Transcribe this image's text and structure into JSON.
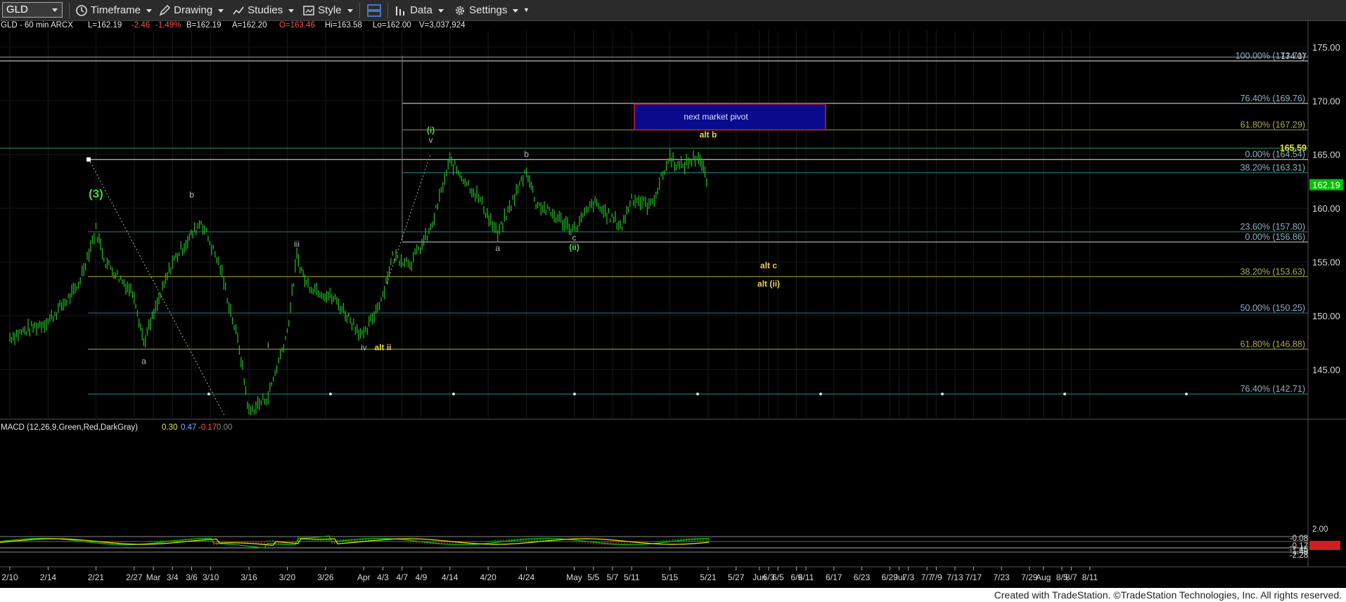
{
  "toolbar": {
    "symbol": "GLD",
    "timeframe": "Timeframe",
    "drawing": "Drawing",
    "studies": "Studies",
    "style": "Style",
    "data": "Data",
    "settings": "Settings"
  },
  "header": {
    "symbol_desc": "GLD - 60 min  ARCX",
    "last": "L=162.19",
    "change": "-2.46",
    "pct": "-1.49%",
    "bid": "B=162.19",
    "ask": "A=162.20",
    "open": "O=163.46",
    "high": "Hi=163.58",
    "low": "Lo=162.00",
    "volume": "V=3,037,924"
  },
  "colors": {
    "background": "#000000",
    "bars": "#22c022",
    "white_label": "#aeb8c8",
    "green_label": "#4dd24d",
    "yellow_label": "#e8d44d",
    "level_teal": "#1e6e6e",
    "level_olive": "#8a8a2a",
    "pivot_box": "#0a0a8c",
    "pivot_border": "#d01e1e",
    "last_price_bg": "#00c000",
    "macd_line": "#00c000",
    "signal_line": "#e0e000",
    "histogram_neg": "#d02020"
  },
  "chart_data": {
    "type": "line",
    "title": "GLD - 60 min",
    "ylim": [
      140.5,
      176.5
    ],
    "y_ticks": [
      145.0,
      150.0,
      155.0,
      160.0,
      165.0,
      170.0,
      175.0
    ],
    "x_tick_labels": [
      "2/10",
      "2/14",
      "2/21",
      "2/27",
      "Mar",
      "3/4",
      "3/6",
      "3/10",
      "3/16",
      "3/20",
      "3/26",
      "Apr",
      "4/3",
      "4/7",
      "4/9",
      "4/14",
      "4/20",
      "4/24",
      "May",
      "5/5",
      "5/7",
      "5/11",
      "5/15",
      "5/21",
      "5/27",
      "Jun",
      "6/3",
      "6/5",
      "6/9",
      "6/11",
      "6/17",
      "6/23",
      "6/29",
      "Jul",
      "7/3",
      "7/7",
      "7/9",
      "7/13",
      "7/17",
      "7/23",
      "7/29",
      "Aug",
      "8/5",
      "8/7",
      "8/11"
    ],
    "price_path": [
      {
        "x": "2/10",
        "y": 148.0
      },
      {
        "x": "2/14",
        "y": 149.5
      },
      {
        "x": "2/19",
        "y": 152.5
      },
      {
        "x": "2/21",
        "y": 158.0
      },
      {
        "x": "2/24",
        "y": 155.0
      },
      {
        "x": "2/27",
        "y": 152.0
      },
      {
        "x": "2/28",
        "y": 147.5
      },
      {
        "x": "3/4",
        "y": 155.0
      },
      {
        "x": "3/7",
        "y": 158.8
      },
      {
        "x": "3/11",
        "y": 154.5
      },
      {
        "x": "3/13",
        "y": 147.0
      },
      {
        "x": "3/16",
        "y": 141.0
      },
      {
        "x": "3/18",
        "y": 142.5
      },
      {
        "x": "3/20",
        "y": 148.5
      },
      {
        "x": "3/21",
        "y": 155.5
      },
      {
        "x": "3/24",
        "y": 153.0
      },
      {
        "x": "3/27",
        "y": 151.5
      },
      {
        "x": "4/1",
        "y": 148.0
      },
      {
        "x": "4/3",
        "y": 152.0
      },
      {
        "x": "4/6",
        "y": 155.5
      },
      {
        "x": "4/8",
        "y": 155.0
      },
      {
        "x": "4/10",
        "y": 158.0
      },
      {
        "x": "4/14",
        "y": 164.4
      },
      {
        "x": "4/17",
        "y": 161.0
      },
      {
        "x": "4/21",
        "y": 157.5
      },
      {
        "x": "4/24",
        "y": 163.6
      },
      {
        "x": "4/27",
        "y": 160.5
      },
      {
        "x": "5/1",
        "y": 158.0
      },
      {
        "x": "5/5",
        "y": 160.5
      },
      {
        "x": "5/8",
        "y": 158.3
      },
      {
        "x": "5/11",
        "y": 161.0
      },
      {
        "x": "5/13",
        "y": 160.2
      },
      {
        "x": "5/15",
        "y": 164.8
      },
      {
        "x": "5/18",
        "y": 163.8
      },
      {
        "x": "5/20",
        "y": 164.9
      },
      {
        "x": "5/21",
        "y": 162.19
      }
    ],
    "levels": [
      {
        "label": "100.00% (173.71)",
        "value": 173.71
      },
      {
        "label": "76.40% (169.76)",
        "value": 169.76
      },
      {
        "label": "61.80% (167.29)",
        "value": 167.29
      },
      {
        "label": "0.00% (164.54)",
        "value": 164.54
      },
      {
        "label": "38.20% (163.31)",
        "value": 163.31
      },
      {
        "label": "23.60% (157.80)",
        "value": 157.8
      },
      {
        "label": "0.00% (156.86)",
        "value": 156.86
      },
      {
        "label": "38.20% (153.63)",
        "value": 153.63
      },
      {
        "label": "50.00% (150.25)",
        "value": 150.25
      },
      {
        "label": "61.80% (146.88)",
        "value": 146.88
      },
      {
        "label": "76.40% (142.71)",
        "value": 142.71
      }
    ],
    "axis_markers": [
      {
        "label": "174.07",
        "value": 174.07
      },
      {
        "label": "165.59",
        "value": 165.59
      },
      {
        "label": "162.19",
        "value": 162.19
      }
    ],
    "pivot_zone": {
      "label": "next market pivot",
      "low": 167.3,
      "high": 169.7
    },
    "annotations": [
      {
        "text": "(3)",
        "color": "green",
        "x": "2/21",
        "y": 161.0
      },
      {
        "text": "b",
        "color": "white",
        "x": "3/6",
        "y": 161.0
      },
      {
        "text": "a",
        "color": "white",
        "x": "2/28",
        "y": 145.5
      },
      {
        "text": "i",
        "color": "white",
        "x": "3/18",
        "y": 147.0
      },
      {
        "text": "iii",
        "color": "white",
        "x": "3/21",
        "y": 156.4
      },
      {
        "text": "iv",
        "color": "white",
        "x": "4/1",
        "y": 146.8
      },
      {
        "text": "alt ii",
        "color": "yellow",
        "x": "4/3",
        "y": 146.8
      },
      {
        "text": "(i)",
        "color": "green",
        "x": "4/10",
        "y": 167.0
      },
      {
        "text": "v",
        "color": "white",
        "x": "4/10",
        "y": 166.1
      },
      {
        "text": "a",
        "color": "white",
        "x": "4/21",
        "y": 156.0
      },
      {
        "text": "b",
        "color": "white",
        "x": "4/24",
        "y": 164.8
      },
      {
        "text": "c",
        "color": "white",
        "x": "5/1",
        "y": 157.0
      },
      {
        "text": "(ii)",
        "color": "green",
        "x": "5/1",
        "y": 156.1
      },
      {
        "text": "alt b",
        "color": "yellow",
        "x": "5/21",
        "y": 166.6
      },
      {
        "text": "alt c",
        "color": "yellow",
        "x": "6/3",
        "y": 154.4
      },
      {
        "text": "alt (ii)",
        "color": "yellow",
        "x": "6/3",
        "y": 152.7
      }
    ],
    "macd": {
      "label": "MACD (12,26,9,Green,Red,DarkGray)",
      "values": [
        "0.30",
        "0.47",
        "-0.17",
        "0.00"
      ],
      "axis_labels": [
        "2.00",
        "-0.08",
        "-0.17",
        "-1.45",
        "-1.46",
        "-2.28"
      ]
    }
  },
  "footer": {
    "text": "Created with TradeStation. ©TradeStation Technologies, Inc. All rights reserved."
  }
}
